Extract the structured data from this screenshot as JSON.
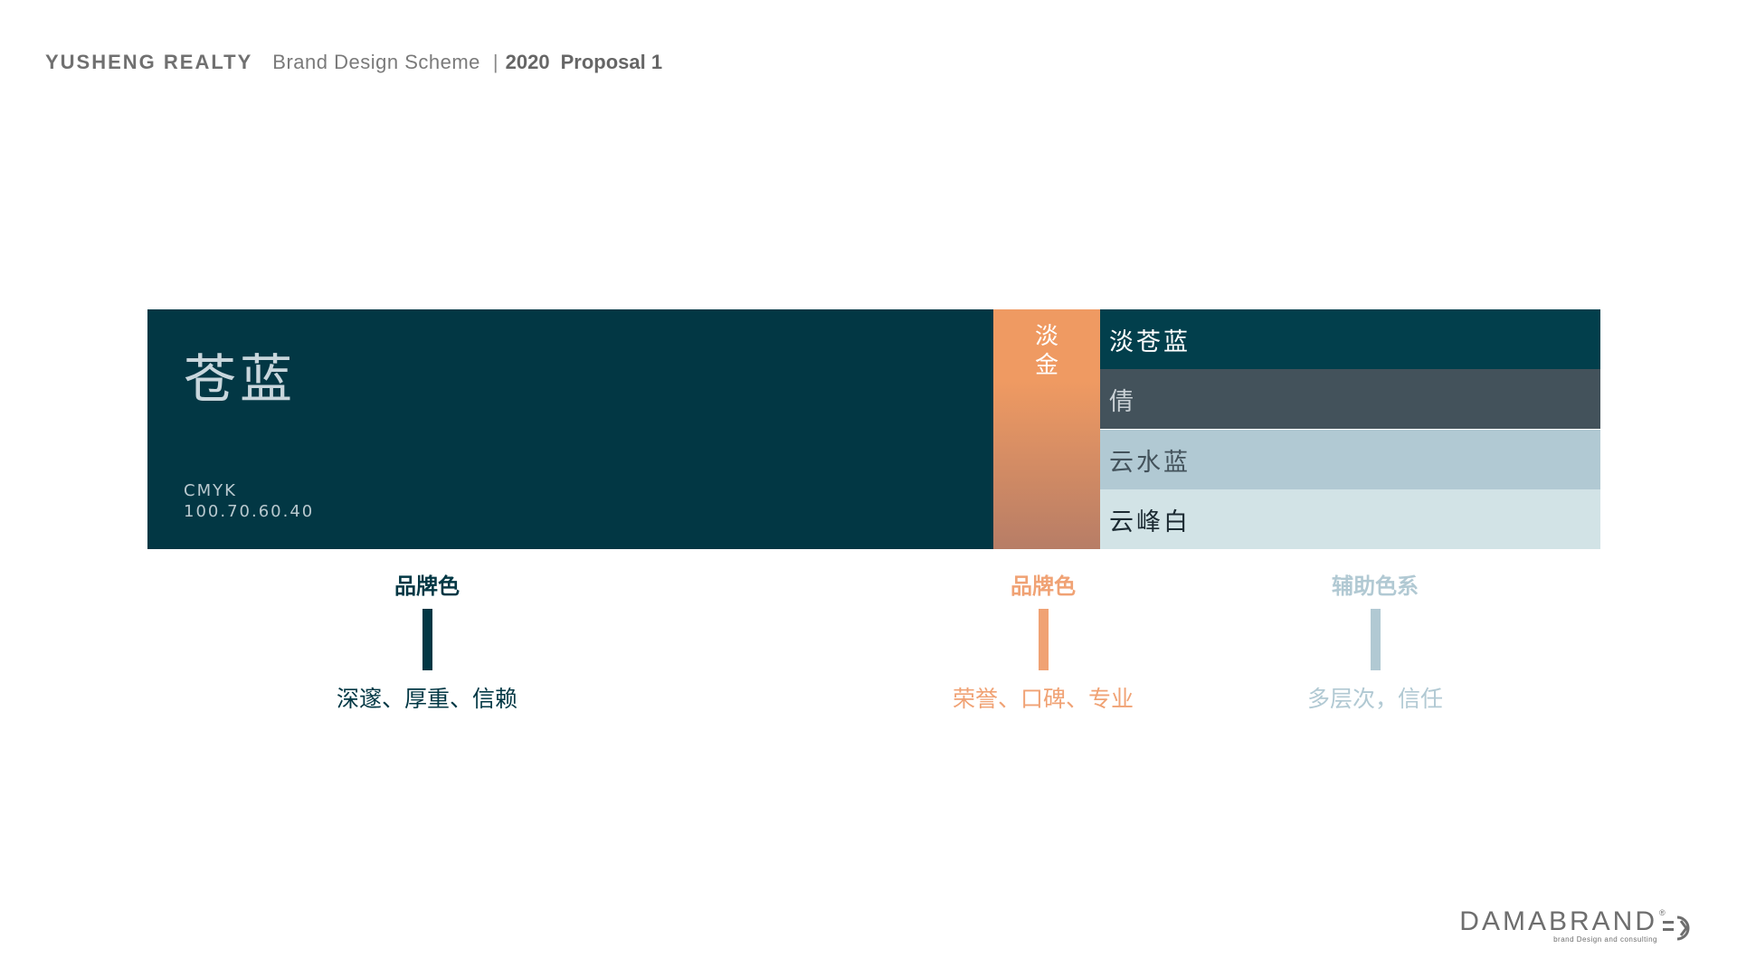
{
  "header": {
    "company": "YUSHENG REALTY",
    "scheme": "Brand Design Scheme",
    "separator": "|",
    "year": "2020",
    "proposal": "Proposal 1"
  },
  "palette": {
    "main": {
      "name": "苍蓝",
      "cmyk_label": "CMYK",
      "cmyk_value": "100.70.60.40",
      "color": "#023744"
    },
    "gold": {
      "name": "淡金",
      "color_top": "#ef9a62",
      "color_bottom": "#b77d66"
    },
    "auxiliary": [
      {
        "name": "淡苍蓝",
        "bg": "#023f4c",
        "fg": "#ffffff"
      },
      {
        "name": "倩",
        "bg": "#43525b",
        "fg": "#c9d0d4"
      },
      {
        "name": "云水蓝",
        "bg": "#b1c9d3",
        "fg": "#43525b"
      },
      {
        "name": "云峰白",
        "bg": "#d2e3e6",
        "fg": "#1c2a32"
      }
    ]
  },
  "categories": [
    {
      "title": "品牌色",
      "desc": "深邃、厚重、信赖",
      "color": "#023744"
    },
    {
      "title": "品牌色",
      "desc": "荣誉、口碑、专业",
      "color": "#f0a274"
    },
    {
      "title": "辅助色系",
      "desc": "多层次，信任",
      "color": "#b1c9d3"
    }
  ],
  "logo": {
    "word": "DAMABRAND",
    "tagline": "brand Design and consulting",
    "registered": "®"
  }
}
